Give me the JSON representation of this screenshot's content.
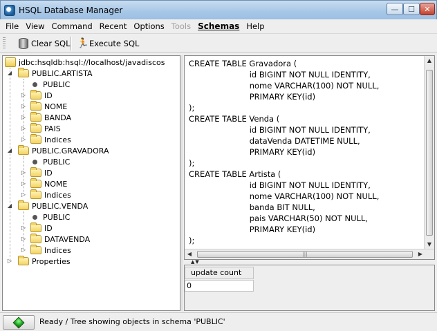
{
  "window": {
    "title": "HSQL Database Manager"
  },
  "menu": [
    "File",
    "View",
    "Command",
    "Recent",
    "Options",
    "Tools",
    "Schemas",
    "Help"
  ],
  "toolbar": {
    "clear_label": "Clear SQL",
    "execute_label": "Execute SQL"
  },
  "tree": {
    "root": "jdbc:hsqldb:hsql://localhost/javadiscos",
    "schemas": [
      {
        "name": "PUBLIC.ARTISTA",
        "items": [
          "PUBLIC",
          "ID",
          "NOME",
          "BANDA",
          "PAIS",
          "Indices"
        ]
      },
      {
        "name": "PUBLIC.GRAVADORA",
        "items": [
          "PUBLIC",
          "ID",
          "NOME",
          "Indices"
        ]
      },
      {
        "name": "PUBLIC.VENDA",
        "items": [
          "PUBLIC",
          "ID",
          "DATAVENDA",
          "Indices"
        ]
      }
    ],
    "properties": "Properties"
  },
  "editor": {
    "lines": [
      "CREATE TABLE Gravadora (",
      "                        id BIGINT NOT NULL IDENTITY,",
      "                        nome VARCHAR(100) NOT NULL,",
      "                        PRIMARY KEY(id)",
      ");",
      "CREATE TABLE Venda (",
      "                        id BIGINT NOT NULL IDENTITY,",
      "                        dataVenda DATETIME NULL,",
      "                        PRIMARY KEY(id)",
      ");",
      "CREATE TABLE Artista (",
      "                        id BIGINT NOT NULL IDENTITY,",
      "                        nome VARCHAR(100) NOT NULL,",
      "                        banda BIT NULL,",
      "                        pais VARCHAR(50) NOT NULL,",
      "                        PRIMARY KEY(id)",
      ");"
    ]
  },
  "results": {
    "header": "update count",
    "value": "0"
  },
  "status": {
    "text": "Ready /  Tree showing objects in schema 'PUBLIC'"
  }
}
